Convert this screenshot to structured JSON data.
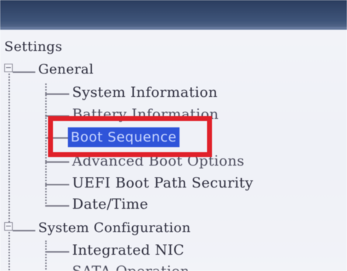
{
  "tree": {
    "root_label": "Settings",
    "expander_symbol": "−",
    "groups": [
      {
        "label": "General",
        "items": [
          {
            "label": "System Information"
          },
          {
            "label": "Battery Information"
          },
          {
            "label": "Boot Sequence",
            "selected": true
          },
          {
            "label": "Advanced Boot Options"
          },
          {
            "label": "UEFI Boot Path Security"
          },
          {
            "label": "Date/Time"
          }
        ]
      },
      {
        "label": "System Configuration",
        "items": [
          {
            "label": "Integrated NIC"
          },
          {
            "label": "SATA Operation"
          }
        ]
      }
    ]
  },
  "colors": {
    "selection_bg": "#2f54d9",
    "annotation_box": "#e0212a"
  }
}
